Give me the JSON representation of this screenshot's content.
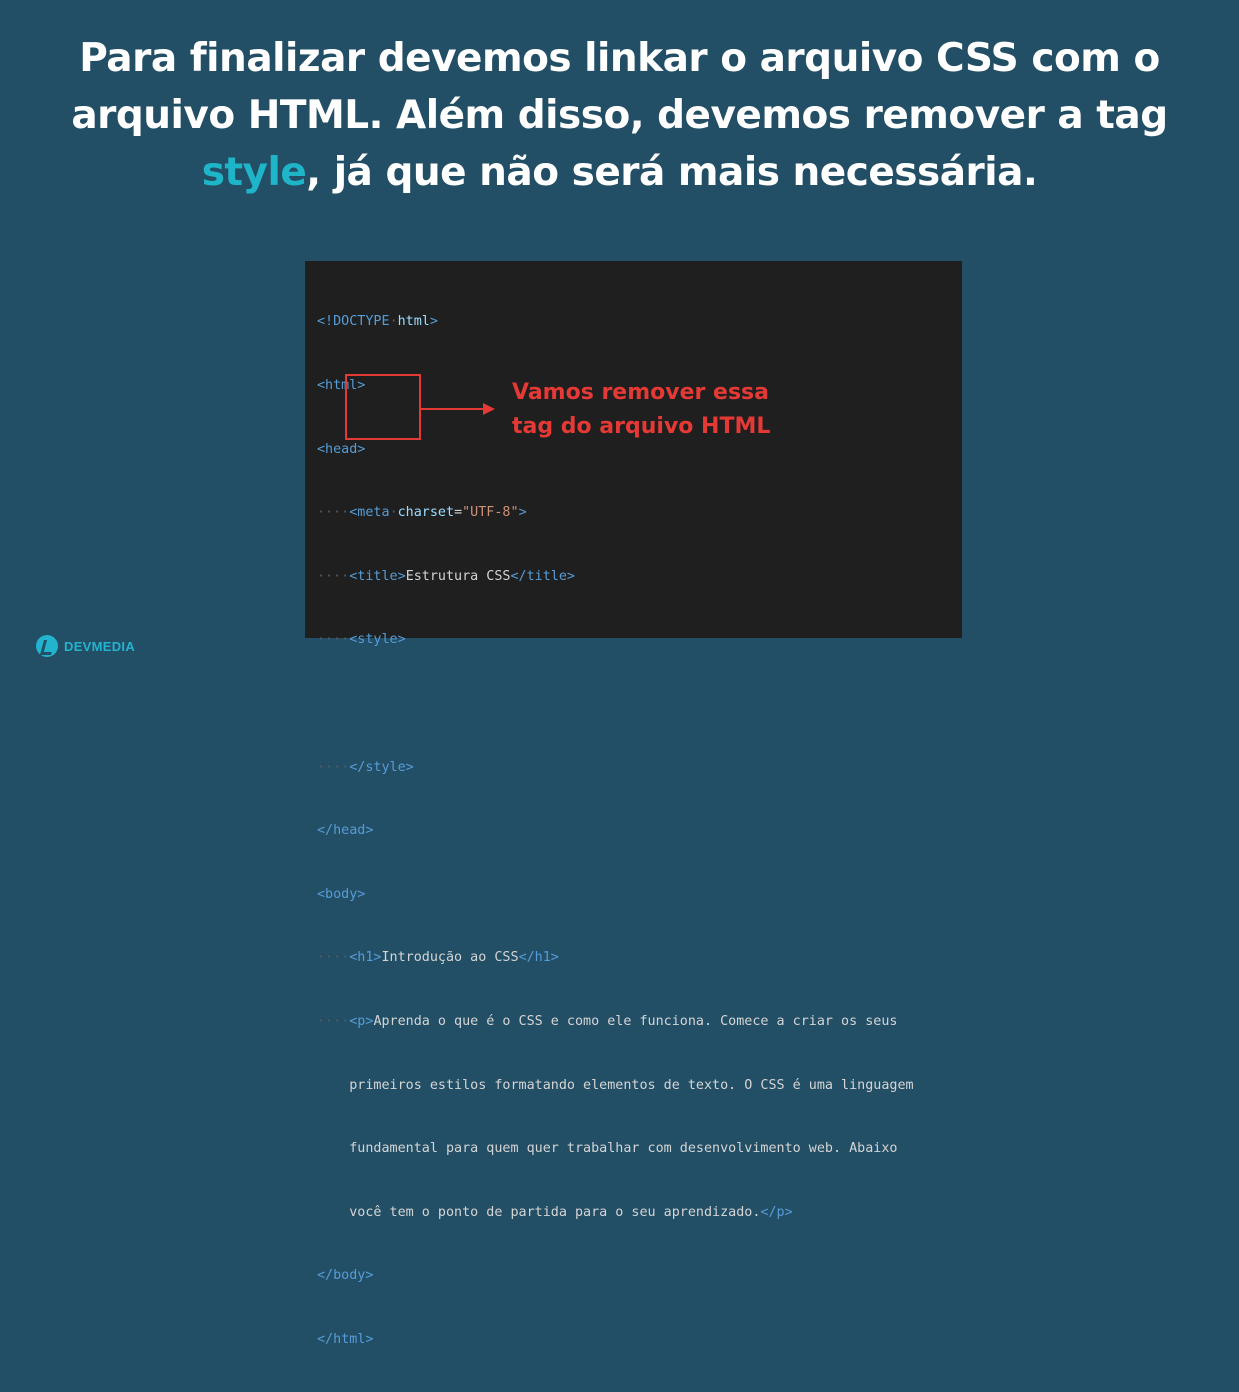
{
  "headline": {
    "line1": "Para finalizar devemos linkar o arquivo CSS com o",
    "line2": "arquivo HTML. Além disso, devemos remover a tag",
    "highlight": "style",
    "line3_rest": ", já que não será mais necessária."
  },
  "callout": {
    "line1": "Vamos remover essa",
    "line2": "tag do arquivo HTML"
  },
  "code": {
    "doctype_open": "<!DOCTYPE",
    "doctype_html": "html",
    "doctype_close": ">",
    "html_open": "<html>",
    "head_open": "<head>",
    "meta_open": "<meta",
    "meta_attr": "charset",
    "meta_eq": "=",
    "meta_val": "\"UTF-8\"",
    "meta_close": ">",
    "title_open": "<title>",
    "title_text": "Estrutura CSS",
    "title_close": "</title>",
    "style_open": "<style>",
    "style_close": "</style>",
    "head_close": "</head>",
    "body_open": "<body>",
    "h1_open": "<h1>",
    "h1_text": "Introdução ao CSS",
    "h1_close": "</h1>",
    "p_open": "<p>",
    "p_line1": "Aprenda o que é o CSS e como ele funciona. Comece a criar os seus",
    "p_line2": "primeiros estilos formatando elementos de texto. O CSS é uma linguagem",
    "p_line3": "fundamental para quem quer trabalhar com desenvolvimento web. Abaixo",
    "p_line4": "você tem o ponto de partida para o seu aprendizado.",
    "p_close": "</p>",
    "body_close": "</body>",
    "html_close": "</html>"
  },
  "logo": {
    "text": "DEVMEDIA",
    "icon": "devmedia-logo-icon"
  },
  "colors": {
    "background": "#234f66",
    "accent": "#1fb5c9",
    "callout": "#e53935",
    "code_bg": "#1f1f1f"
  }
}
